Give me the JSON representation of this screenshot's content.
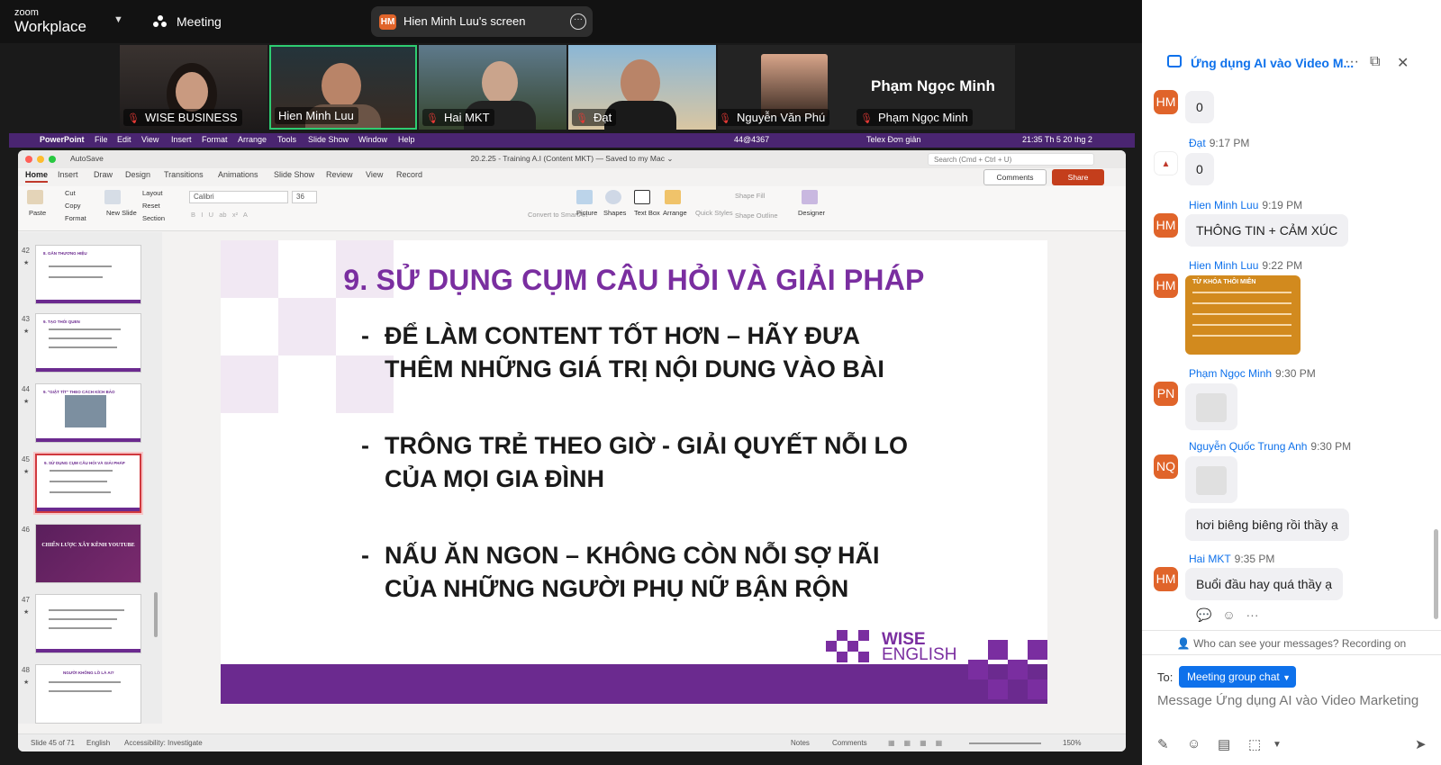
{
  "topbar": {
    "brand_small": "zoom",
    "brand_large": "Workplace",
    "meeting_label": "Meeting",
    "share_avatar": "HM",
    "share_title": "Hien Minh Luu's screen"
  },
  "participants": [
    {
      "name": "WISE BUSINESS"
    },
    {
      "name": "Hien Minh Luu"
    },
    {
      "name": "Hai MKT"
    },
    {
      "name": "Đạt"
    },
    {
      "name": "Nguyễn Văn Phú"
    },
    {
      "name": "Phạm Ngọc Minh",
      "big_label": "Phạm Ngọc Minh"
    }
  ],
  "macbar": {
    "app": "PowerPoint",
    "menus": [
      "File",
      "Edit",
      "View",
      "Insert",
      "Format",
      "Arrange",
      "Tools",
      "Slide Show",
      "Window",
      "Help"
    ],
    "right_items": [
      "44@4367",
      "Telex Đơn giản",
      "21:35 Th 5 20 thg 2"
    ]
  },
  "ppt": {
    "autosave": "AutoSave",
    "doc_title": "20.2.25 - Training A.I (Content MKT) — Saved to my Mac ⌄",
    "search_placeholder": "Search (Cmd + Ctrl + U)",
    "tabs": [
      "Home",
      "Insert",
      "Draw",
      "Design",
      "Transitions",
      "Animations",
      "Slide Show",
      "Review",
      "View",
      "Record"
    ],
    "comments_label": "Comments",
    "share_label": "Share",
    "ribbon": {
      "paste": "Paste",
      "cut": "Cut",
      "copy": "Copy",
      "format": "Format",
      "new_slide": "New Slide",
      "layout": "Layout",
      "reset": "Reset",
      "section": "Section",
      "font": "Calibri",
      "size": "36",
      "convert": "Convert to SmartArt",
      "picture": "Picture",
      "shapes": "Shapes",
      "textbox": "Text Box",
      "arrange": "Arrange",
      "quick_styles": "Quick Styles",
      "shape_fill": "Shape Fill",
      "shape_outline": "Shape Outline",
      "designer": "Designer"
    },
    "thumbnails": [
      {
        "num": "42",
        "title": "8. GẮN THƯƠNG HIỆU"
      },
      {
        "num": "43",
        "title": "9. TẠO THÓI QUEN"
      },
      {
        "num": "44",
        "title": "9. \"GIẬT TÍT\" THEO CÁCH KÍCH BẢO"
      },
      {
        "num": "45",
        "title": "9. SỬ DỤNG CỤM CÂU HỎI VÀ GIẢI PHÁP"
      },
      {
        "num": "46",
        "title": "CHIẾN LƯỢC XÂY KÊNH YOUTUBE"
      },
      {
        "num": "47",
        "title": ""
      },
      {
        "num": "48",
        "title": "NGƯỜI KHÔNG LỒ LÀ AI?"
      }
    ],
    "slide": {
      "title": "9. SỬ DỤNG CỤM CÂU HỎI VÀ GIẢI PHÁP",
      "bullets": [
        {
          "line1": "ĐỂ LÀM CONTENT TỐT HƠN – HÃY ĐƯA",
          "line2": "THÊM NHỮNG GIÁ TRỊ NỘI DUNG VÀO BÀI"
        },
        {
          "line1": "TRÔNG TRẺ THEO GIỜ - GIẢI QUYẾT NỖI LO",
          "line2": "CỦA MỌI GIA ĐÌNH"
        },
        {
          "line1": "NẤU ĂN NGON – KHÔNG CÒN NỖI SỢ HÃI",
          "line2": "CỦA NHỮNG NGƯỜI PHỤ NỮ BẬN RỘN"
        }
      ],
      "brand_top": "WISE",
      "brand_bottom": "ENGLISH"
    },
    "status": {
      "slide": "Slide 45 of 71",
      "lang": "English",
      "accessibility": "Accessibility: Investigate",
      "notes": "Notes",
      "comments": "Comments",
      "zoom": "150%"
    }
  },
  "chat": {
    "title": "Ứng dụng AI vào Video M...",
    "messages": [
      {
        "avatar": "HM",
        "avatar_color": "#e0642a",
        "sender": "",
        "time": "",
        "text": "0"
      },
      {
        "avatar": "",
        "avatar_color": "#ffffff",
        "sender": "Đạt",
        "time": "9:17 PM",
        "text": "0"
      },
      {
        "avatar": "HM",
        "avatar_color": "#e0642a",
        "sender": "Hien Minh Luu",
        "time": "9:19 PM",
        "text": "THÔNG TIN + CẢM XÚC"
      },
      {
        "avatar": "HM",
        "avatar_color": "#e0642a",
        "sender": "Hien Minh Luu",
        "time": "9:22 PM",
        "text": ""
      },
      {
        "avatar": "PN",
        "avatar_color": "#e0642a",
        "sender": "Phạm Ngọc Minh",
        "time": "9:30 PM",
        "text": ""
      },
      {
        "avatar": "NQ",
        "avatar_color": "#e0642a",
        "sender": "Nguyễn Quốc Trung Anh",
        "time": "9:30 PM",
        "text": "hơi biêng biêng rồi thầy ạ"
      },
      {
        "avatar": "HM",
        "avatar_color": "#e0642a",
        "sender": "Hai MKT",
        "time": "9:35 PM",
        "text": "Buổi đầu hay quá thầy ạ"
      }
    ],
    "image_caption": "TỪ KHÓA THÔI MIÊN",
    "privacy": "Who can see your messages? Recording on",
    "to_label": "To:",
    "to_value": "Meeting group chat",
    "input_placeholder": "Message Ứng dụng AI vào Video Marketing"
  },
  "colors": {
    "zoom_blue": "#0e71eb",
    "purple": "#7a2ea0",
    "share_red": "#c43e1c",
    "active_speaker": "#2ecc71",
    "mac_bar": "#4a2571"
  }
}
